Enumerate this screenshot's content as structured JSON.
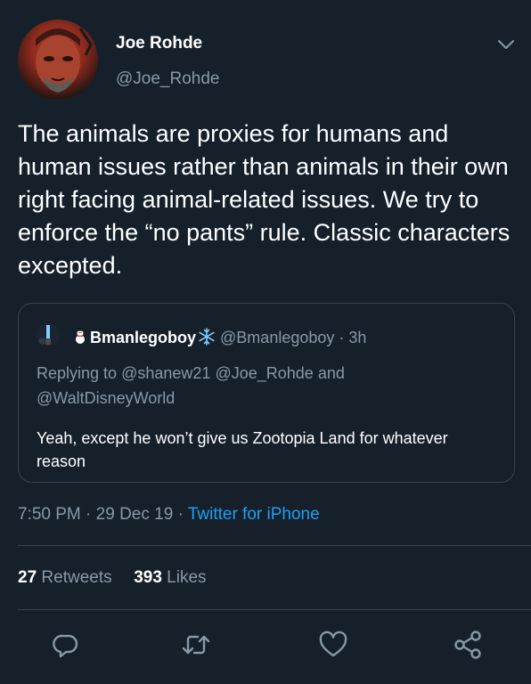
{
  "author": {
    "display_name": "Joe Rohde",
    "handle": "@Joe_Rohde"
  },
  "tweet": {
    "text": "The animals are proxies for humans and human issues rather than animals in their own right facing animal-related issues. We try to enforce the “no pants” rule. Classic characters excepted."
  },
  "quoted_tweet": {
    "display_name": "Bmanlegoboy",
    "handle": "@Bmanlegoboy",
    "separator": "·",
    "time": "3h",
    "replying_label": "Replying to",
    "reply_to_1": "@shanew21",
    "reply_to_2": "@Joe_Rohde",
    "reply_and": "and",
    "reply_to_3": "@WaltDisneyWorld",
    "text": "Yeah, except he won’t give us Zootopia Land for whatever reason"
  },
  "meta": {
    "time": "7:50 PM",
    "separator": "·",
    "date": "29 Dec 19",
    "source": "Twitter for iPhone"
  },
  "stats": {
    "retweets_count": "27",
    "retweets_label": "Retweets",
    "likes_count": "393",
    "likes_label": "Likes"
  },
  "actions": {
    "reply_icon": "reply-icon",
    "retweet_icon": "retweet-icon",
    "like_icon": "heart-icon",
    "share_icon": "share-icon"
  },
  "colors": {
    "background": "#15202b",
    "secondary_text": "#8899a6",
    "link": "#1da1f2",
    "border": "#38444d"
  }
}
